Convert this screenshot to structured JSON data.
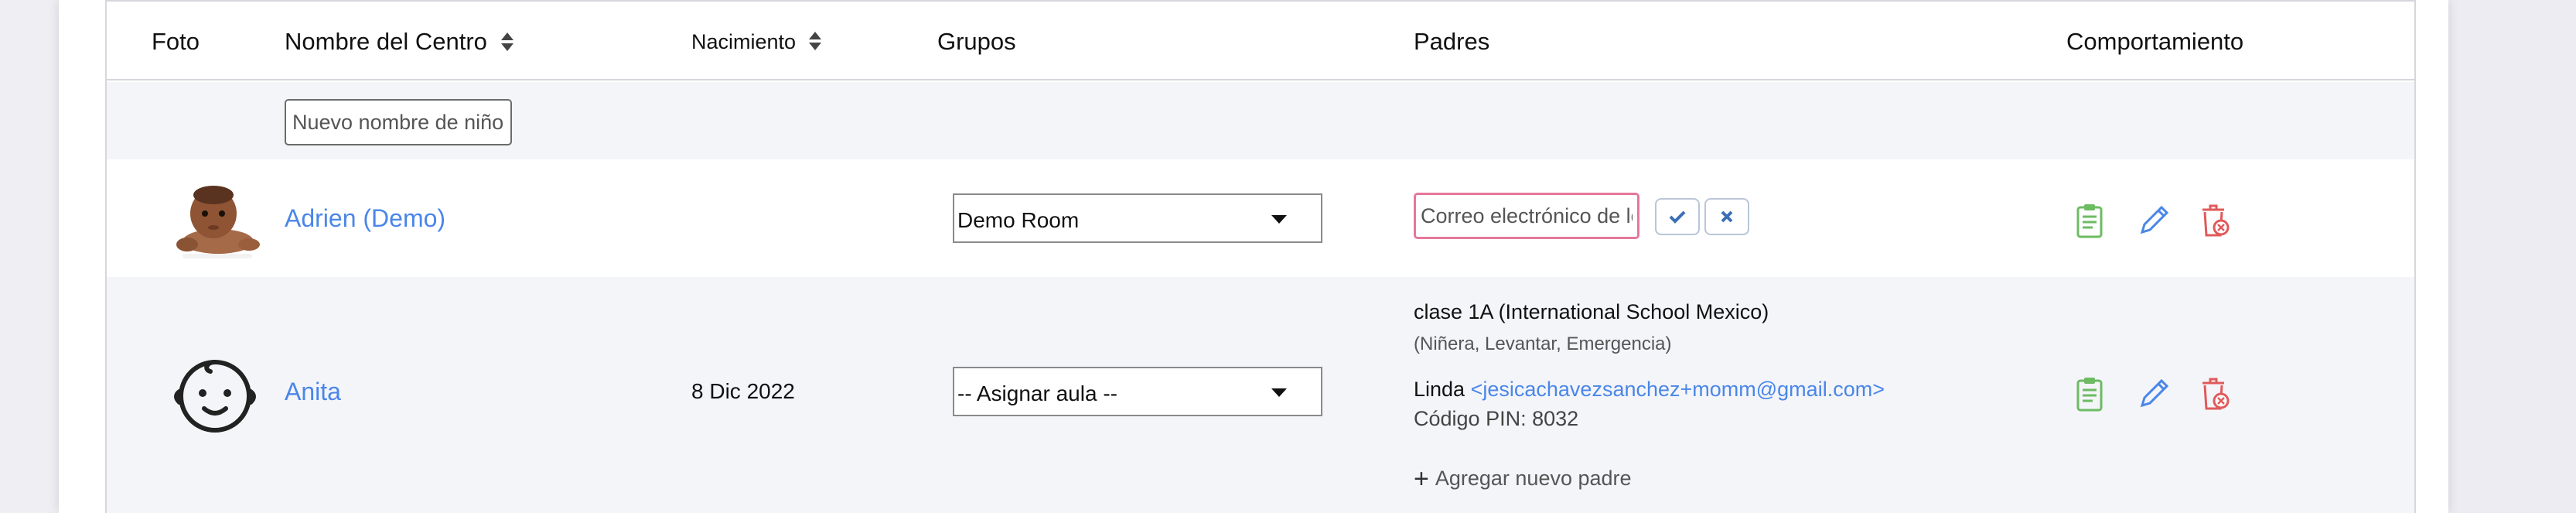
{
  "header": {
    "photo": "Foto",
    "name": "Nombre del Centro",
    "birth": "Nacimiento",
    "groups": "Grupos",
    "parents": "Padres",
    "behavior": "Comportamiento"
  },
  "new_child": {
    "placeholder": "Nuevo nombre de niño"
  },
  "rows": [
    {
      "name": "Adrien (Demo)",
      "birth": "",
      "group": "Demo Room",
      "email_placeholder": "Correo electrónico de los padres"
    },
    {
      "name": "Anita",
      "birth": "8 Dic 2022",
      "group": "-- Asignar aula --",
      "parent_class": "clase 1A (International School Mexico)",
      "parent_roles": "(Niñera, Levantar, Emergencia)",
      "parent_name": "Linda",
      "parent_email": "<jesicachavezsanchez+momm@gmail.com>",
      "pin": "Código PIN: 8032",
      "add_parent": "Agregar nuevo padre"
    }
  ],
  "icons": {
    "sort": "sort-icon",
    "report": "clipboard-icon",
    "edit": "pencil-icon",
    "delete": "trash-icon",
    "confirm": "check-icon",
    "cancel": "close-icon",
    "add": "plus-icon",
    "baby_avatar": "baby-face-icon"
  },
  "colors": {
    "link": "#4a86e8",
    "report_icon": "#6dbb63",
    "edit_icon": "#4a86e8",
    "delete_icon": "#e05a5a",
    "email_input_border": "#e5789a"
  }
}
